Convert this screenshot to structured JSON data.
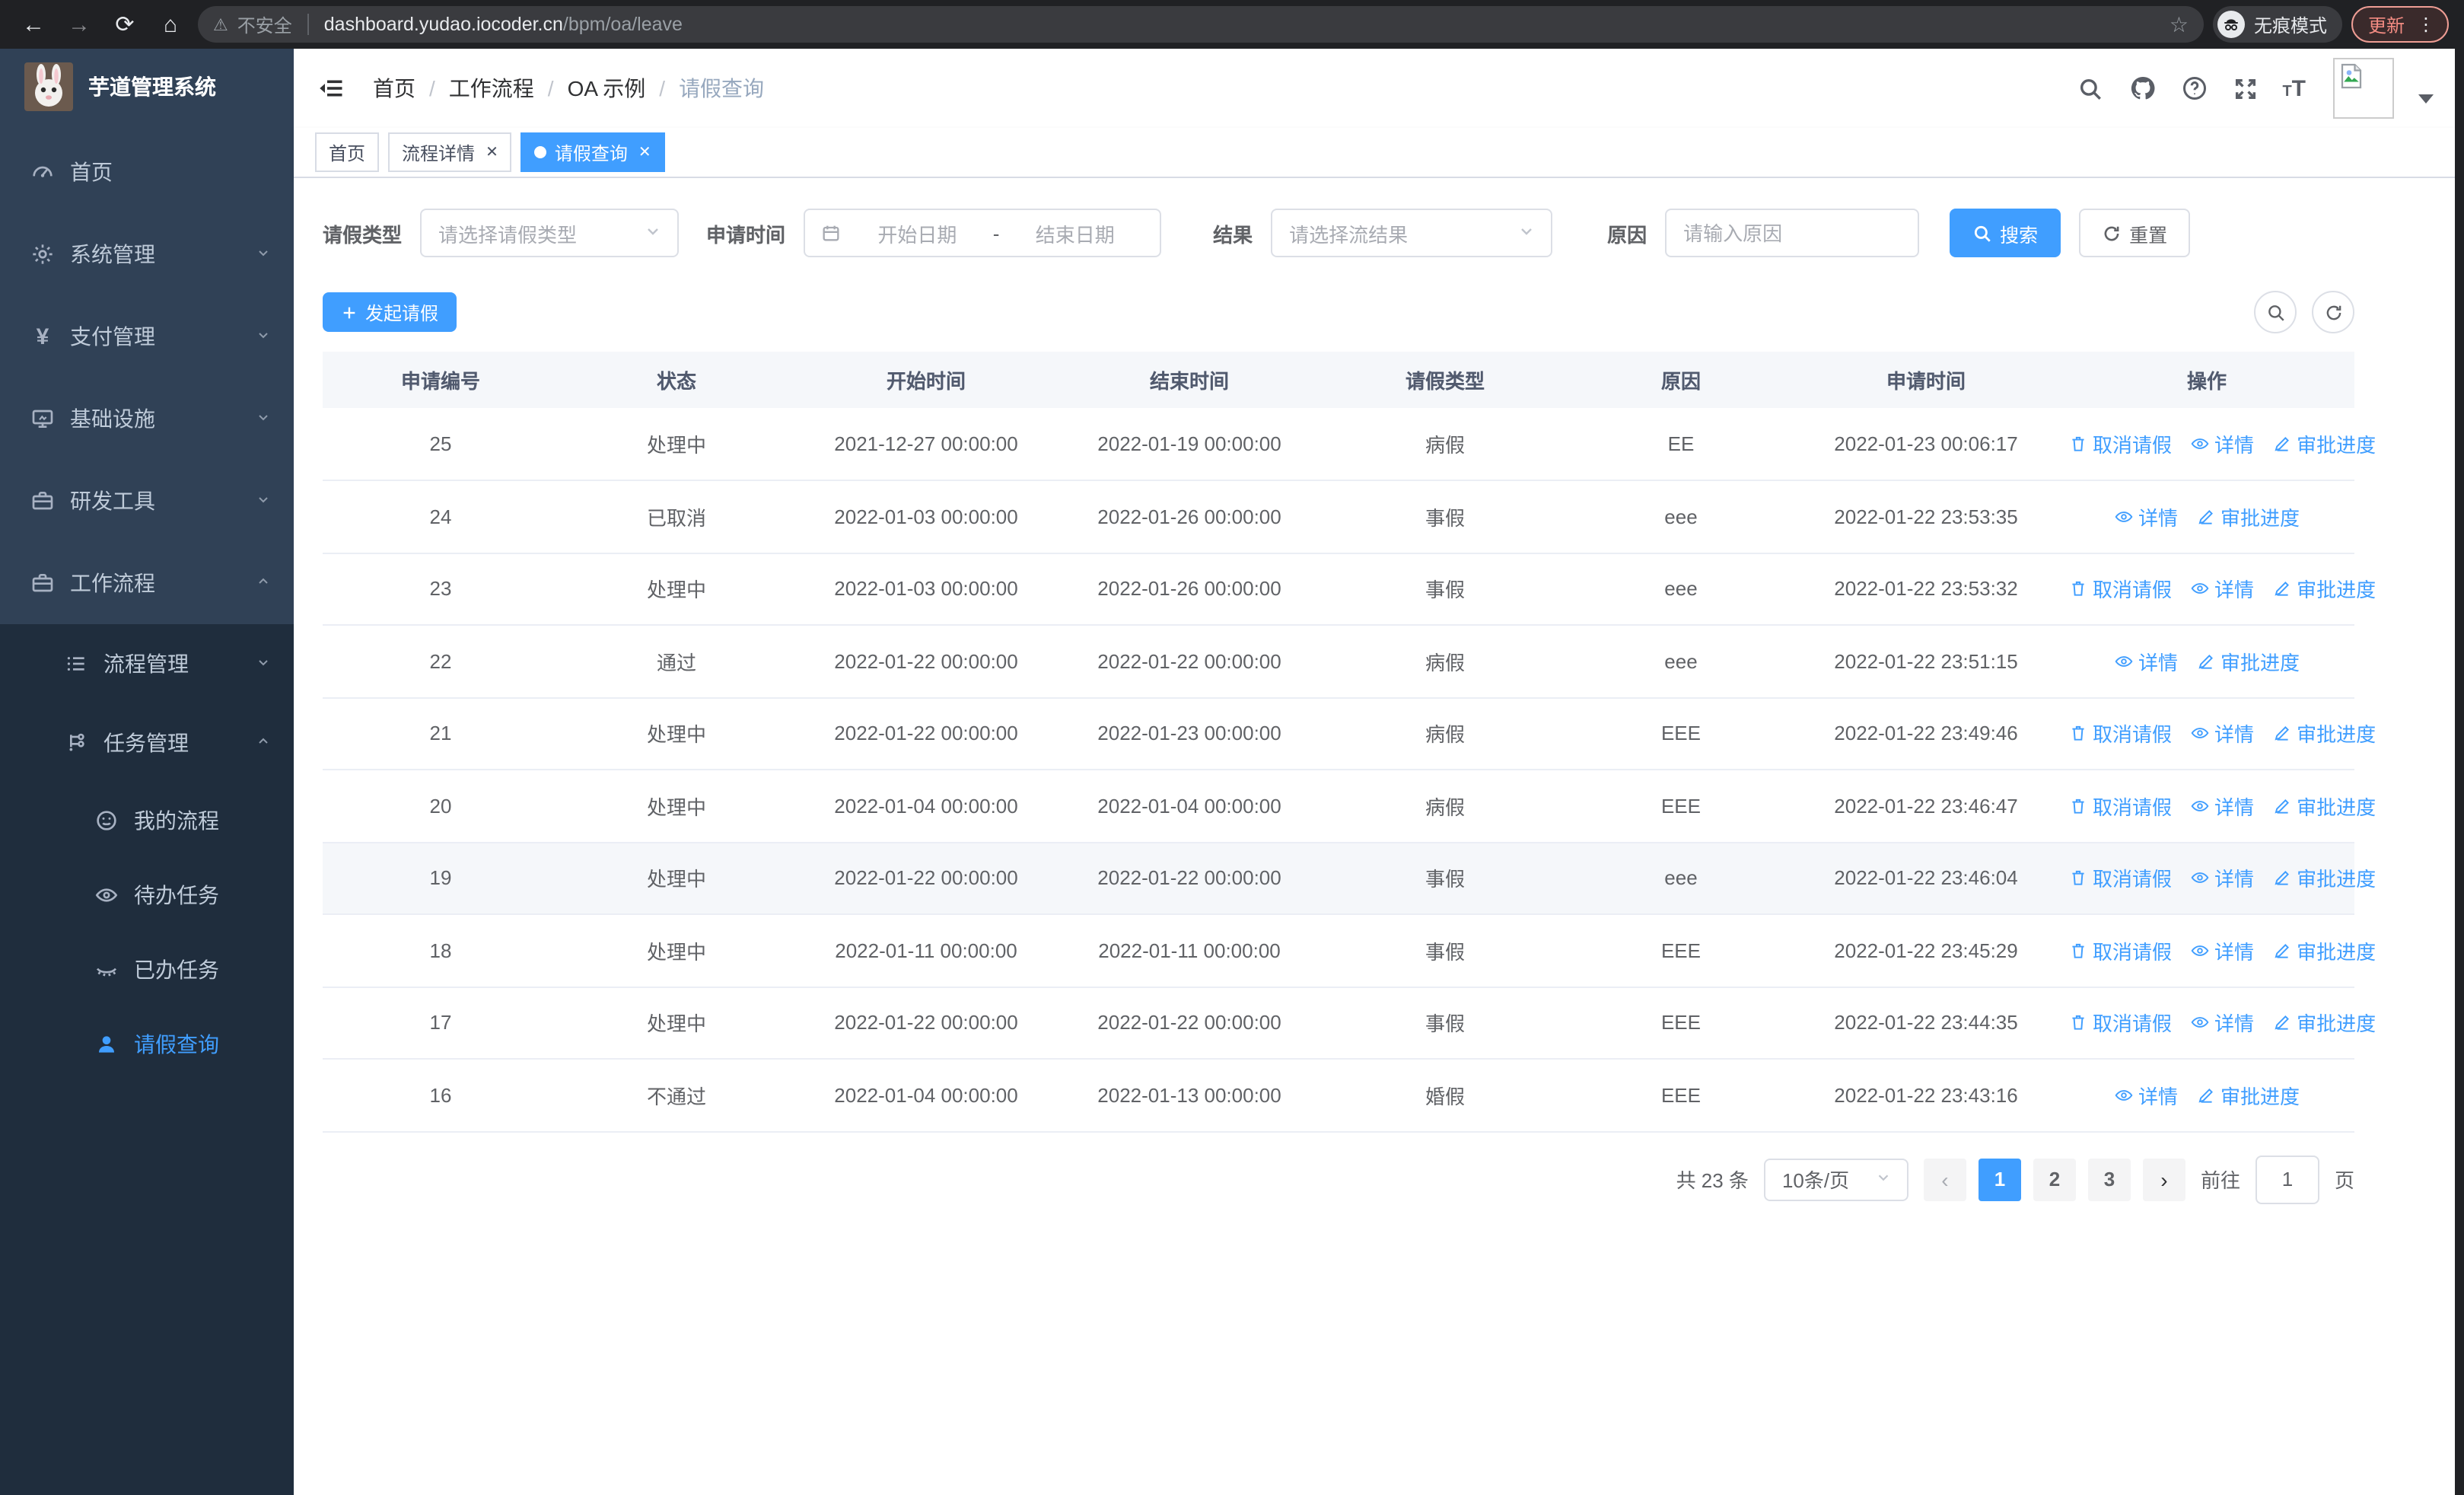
{
  "browser": {
    "security_label": "不安全",
    "url_host": "dashboard.yudao.iocoder.cn",
    "url_path": "/bpm/oa/leave",
    "incognito_label": "无痕模式",
    "update_label": "更新"
  },
  "sidebar": {
    "title": "芋道管理系统",
    "items": [
      {
        "key": "home",
        "label": "首页",
        "icon": "dashboard-icon",
        "level": 1,
        "expandable": false
      },
      {
        "key": "system",
        "label": "系统管理",
        "icon": "gear-icon",
        "level": 1,
        "expandable": true,
        "expanded": false
      },
      {
        "key": "payment",
        "label": "支付管理",
        "icon": "yen-icon",
        "level": 1,
        "expandable": true,
        "expanded": false
      },
      {
        "key": "infra",
        "label": "基础设施",
        "icon": "monitor-icon",
        "level": 1,
        "expandable": true,
        "expanded": false
      },
      {
        "key": "devtools",
        "label": "研发工具",
        "icon": "briefcase-icon",
        "level": 1,
        "expandable": true,
        "expanded": false
      },
      {
        "key": "workflow",
        "label": "工作流程",
        "icon": "briefcase-icon",
        "level": 1,
        "expandable": true,
        "expanded": true
      },
      {
        "key": "process-mgmt",
        "label": "流程管理",
        "icon": "list-icon",
        "level": 2,
        "expandable": true,
        "expanded": false
      },
      {
        "key": "task-mgmt",
        "label": "任务管理",
        "icon": "tree-icon",
        "level": 2,
        "expandable": true,
        "expanded": true
      },
      {
        "key": "my-process",
        "label": "我的流程",
        "icon": "face-icon",
        "level": 3
      },
      {
        "key": "todo-task",
        "label": "待办任务",
        "icon": "eye-open-icon",
        "level": 3
      },
      {
        "key": "done-task",
        "label": "已办任务",
        "icon": "eye-closed-icon",
        "level": 3
      },
      {
        "key": "leave-query",
        "label": "请假查询",
        "icon": "user-icon",
        "level": 3,
        "active": true
      }
    ]
  },
  "navbar": {
    "breadcrumb": [
      "首页",
      "工作流程",
      "OA 示例",
      "请假查询"
    ]
  },
  "tabs": [
    {
      "label": "首页",
      "closable": false,
      "active": false
    },
    {
      "label": "流程详情",
      "closable": true,
      "active": false
    },
    {
      "label": "请假查询",
      "closable": true,
      "active": true
    }
  ],
  "page": {
    "filters": {
      "leave_type_label": "请假类型",
      "leave_type_placeholder": "请选择请假类型",
      "apply_time_label": "申请时间",
      "date_start_placeholder": "开始日期",
      "date_separator": "-",
      "date_end_placeholder": "结束日期",
      "result_label": "结果",
      "result_placeholder": "请选择流结果",
      "reason_label": "原因",
      "reason_placeholder": "请输入原因",
      "search_button": "搜索",
      "reset_button": "重置"
    },
    "toolbar": {
      "create_button": "发起请假"
    },
    "table": {
      "columns": [
        "申请编号",
        "状态",
        "开始时间",
        "结束时间",
        "请假类型",
        "原因",
        "申请时间",
        "操作"
      ],
      "action_labels": {
        "cancel": "取消请假",
        "detail": "详情",
        "progress": "审批进度"
      },
      "rows": [
        {
          "id": "25",
          "status": "处理中",
          "start": "2021-12-27 00:00:00",
          "end": "2022-01-19 00:00:00",
          "type": "病假",
          "reason": "EE",
          "applied": "2022-01-23 00:06:17",
          "actions": [
            "cancel",
            "detail",
            "progress"
          ],
          "hover": false
        },
        {
          "id": "24",
          "status": "已取消",
          "start": "2022-01-03 00:00:00",
          "end": "2022-01-26 00:00:00",
          "type": "事假",
          "reason": "eee",
          "applied": "2022-01-22 23:53:35",
          "actions": [
            "detail",
            "progress"
          ],
          "hover": false
        },
        {
          "id": "23",
          "status": "处理中",
          "start": "2022-01-03 00:00:00",
          "end": "2022-01-26 00:00:00",
          "type": "事假",
          "reason": "eee",
          "applied": "2022-01-22 23:53:32",
          "actions": [
            "cancel",
            "detail",
            "progress"
          ],
          "hover": false
        },
        {
          "id": "22",
          "status": "通过",
          "start": "2022-01-22 00:00:00",
          "end": "2022-01-22 00:00:00",
          "type": "病假",
          "reason": "eee",
          "applied": "2022-01-22 23:51:15",
          "actions": [
            "detail",
            "progress"
          ],
          "hover": false
        },
        {
          "id": "21",
          "status": "处理中",
          "start": "2022-01-22 00:00:00",
          "end": "2022-01-23 00:00:00",
          "type": "病假",
          "reason": "EEE",
          "applied": "2022-01-22 23:49:46",
          "actions": [
            "cancel",
            "detail",
            "progress"
          ],
          "hover": false
        },
        {
          "id": "20",
          "status": "处理中",
          "start": "2022-01-04 00:00:00",
          "end": "2022-01-04 00:00:00",
          "type": "病假",
          "reason": "EEE",
          "applied": "2022-01-22 23:46:47",
          "actions": [
            "cancel",
            "detail",
            "progress"
          ],
          "hover": false
        },
        {
          "id": "19",
          "status": "处理中",
          "start": "2022-01-22 00:00:00",
          "end": "2022-01-22 00:00:00",
          "type": "事假",
          "reason": "eee",
          "applied": "2022-01-22 23:46:04",
          "actions": [
            "cancel",
            "detail",
            "progress"
          ],
          "hover": true
        },
        {
          "id": "18",
          "status": "处理中",
          "start": "2022-01-11 00:00:00",
          "end": "2022-01-11 00:00:00",
          "type": "事假",
          "reason": "EEE",
          "applied": "2022-01-22 23:45:29",
          "actions": [
            "cancel",
            "detail",
            "progress"
          ],
          "hover": false
        },
        {
          "id": "17",
          "status": "处理中",
          "start": "2022-01-22 00:00:00",
          "end": "2022-01-22 00:00:00",
          "type": "事假",
          "reason": "EEE",
          "applied": "2022-01-22 23:44:35",
          "actions": [
            "cancel",
            "detail",
            "progress"
          ],
          "hover": false
        },
        {
          "id": "16",
          "status": "不通过",
          "start": "2022-01-04 00:00:00",
          "end": "2022-01-13 00:00:00",
          "type": "婚假",
          "reason": "EEE",
          "applied": "2022-01-22 23:43:16",
          "actions": [
            "detail",
            "progress"
          ],
          "hover": false
        }
      ]
    },
    "pagination": {
      "total_label": "共 23 条",
      "page_size": "10条/页",
      "pages": [
        "1",
        "2",
        "3"
      ],
      "active_page": "1",
      "goto_label": "前往",
      "goto_value": "1",
      "page_unit": "页"
    }
  },
  "colors": {
    "accent": "#409eff",
    "sidebar_bg": "#304156",
    "submenu_bg": "#1f2d3d",
    "link": "#409eff",
    "update_red": "#f28b82"
  }
}
